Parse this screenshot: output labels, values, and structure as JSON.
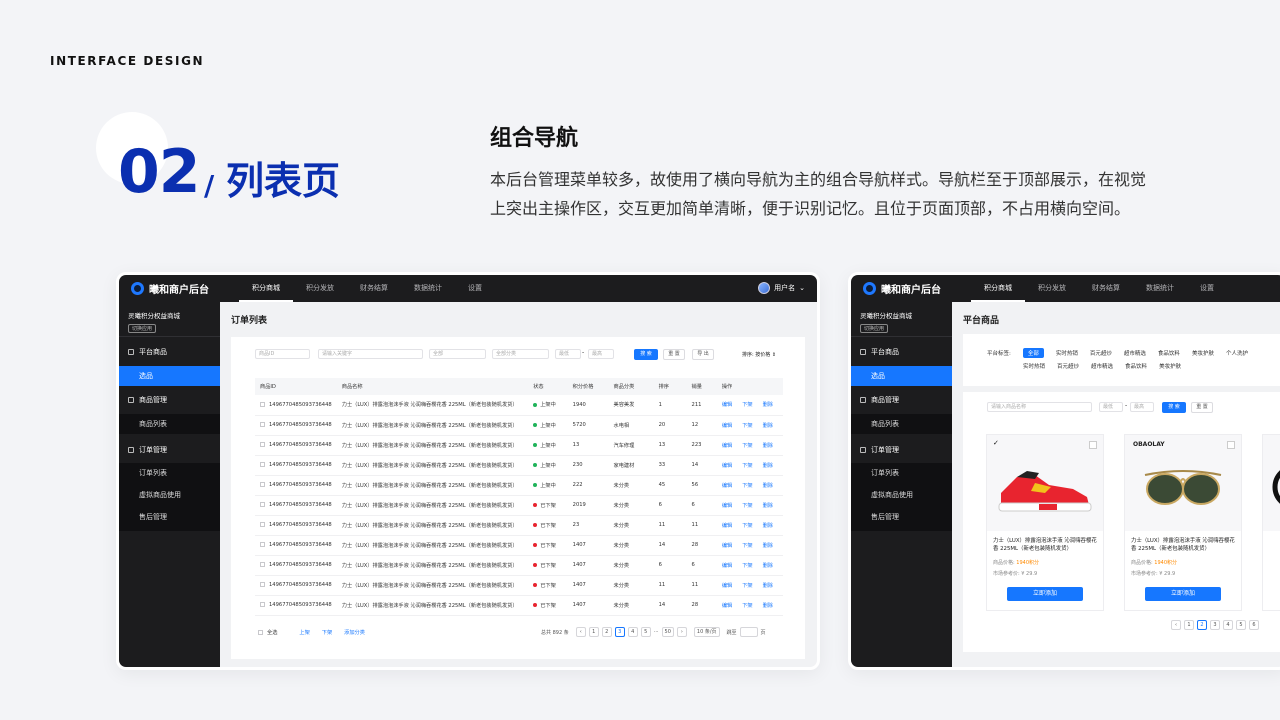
{
  "header": {
    "kicker": "INTERFACE DESIGN",
    "number": "02",
    "slash": "/",
    "title": "列表页"
  },
  "section": {
    "title": "组合导航",
    "line1": "本后台管理菜单较多，故使用了横向导航为主的组合导航样式。导航栏至于顶部展示，在视觉",
    "line2": "上突出主操作区，交互更加简单清晰，便于识别记忆。且位于页面顶部，不占用横向空间。"
  },
  "app": {
    "logo": "曦和商户后台",
    "nav": [
      "积分商城",
      "积分发放",
      "财务结算",
      "数据统计",
      "设置"
    ],
    "user": "用户名",
    "chevron": "⌄",
    "shop": "灵曦积分权益商城",
    "shop_switch": "切换应用"
  },
  "menu": {
    "g1": "平台商品",
    "g1_items": [
      "选品"
    ],
    "g2": "商品管理",
    "g2_items": [
      "商品列表"
    ],
    "g3": "订单管理",
    "g3_items": [
      "订单列表",
      "虚拟商品使用",
      "售后管理"
    ]
  },
  "orders": {
    "page_title": "订单列表",
    "filters": {
      "product_id": "商品ID",
      "keyword": "请输入关键字",
      "all1": "全部",
      "all2": "全部分类",
      "from": "最低",
      "dash": "-",
      "to": "最高",
      "search": "搜 索",
      "reset": "重 置",
      "export": "导 出",
      "sort_label": "排序:",
      "sort_value": "按价格 ⇕"
    },
    "columns": [
      "商品ID",
      "商品名称",
      "状态",
      "积分价格",
      "商品分类",
      "排序",
      "销量",
      "操作"
    ],
    "rows": [
      {
        "id": "14967704850937364​48",
        "name": "力士（LUX）排露泡泡沫手液 沁润嗨吞樱花香 225ML（新老包装随机发货）",
        "status": "上架中",
        "on": true,
        "price": "1940",
        "cat": "美容美发",
        "sort": "1",
        "sales": "211"
      },
      {
        "id": "1496770485093736448",
        "name": "力士（LUX）排露泡泡沫手液 沁润嗨吞樱花香 225ML（新老包装随机发货）",
        "status": "上架中",
        "on": true,
        "price": "5720",
        "cat": "水电相",
        "sort": "20",
        "sales": "12"
      },
      {
        "id": "1496770485093736448",
        "name": "力士（LUX）排露泡泡沫手液 沁润嗨吞樱花香 225ML（新老包装随机发货）",
        "status": "上架中",
        "on": true,
        "price": "13",
        "cat": "汽车修理",
        "sort": "13",
        "sales": "223"
      },
      {
        "id": "1496770485093736448",
        "name": "力士（LUX）排露泡泡沫手液 沁润嗨吞樱花香 225ML（新老包装随机发货）",
        "status": "上架中",
        "on": true,
        "price": "230",
        "cat": "家电建材",
        "sort": "33",
        "sales": "14"
      },
      {
        "id": "1496770485093736448",
        "name": "力士（LUX）排露泡泡沫手液 沁润嗨吞樱花香 225ML（新老包装随机发货）",
        "status": "上架中",
        "on": true,
        "price": "222",
        "cat": "未分类",
        "sort": "45",
        "sales": "56"
      },
      {
        "id": "1496770485093736448",
        "name": "力士（LUX）排露泡泡沫手液 沁润嗨吞樱花香 225ML（新老包装随机发货）",
        "status": "已下架",
        "on": false,
        "price": "2019",
        "cat": "未分类",
        "sort": "6",
        "sales": "6"
      },
      {
        "id": "1496770485093736448",
        "name": "力士（LUX）排露泡泡沫手液 沁润嗨吞樱花香 225ML（新老包装随机发货）",
        "status": "已下架",
        "on": false,
        "price": "23",
        "cat": "未分类",
        "sort": "11",
        "sales": "11"
      },
      {
        "id": "1496770485093736448",
        "name": "力士（LUX）排露泡泡沫手液 沁润嗨吞樱花香 225ML（新老包装随机发货）",
        "status": "已下架",
        "on": false,
        "price": "1407",
        "cat": "未分类",
        "sort": "14",
        "sales": "28"
      },
      {
        "id": "1496770485093736448",
        "name": "力士（LUX）排露泡泡沫手液 沁润嗨吞樱花香 225ML（新老包装随机发货）",
        "status": "已下架",
        "on": false,
        "price": "1407",
        "cat": "未分类",
        "sort": "6",
        "sales": "6"
      },
      {
        "id": "1496770485093736448",
        "name": "力士（LUX）排露泡泡沫手液 沁润嗨吞樱花香 225ML（新老包装随机发货）",
        "status": "已下架",
        "on": false,
        "price": "1407",
        "cat": "未分类",
        "sort": "11",
        "sales": "11"
      },
      {
        "id": "1496770485093736448",
        "name": "力士（LUX）排露泡泡沫手液 沁润嗨吞樱花香 225ML（新老包装随机发货）",
        "status": "已下架",
        "on": false,
        "price": "1407",
        "cat": "未分类",
        "sort": "14",
        "sales": "28"
      }
    ],
    "actions": [
      "编辑",
      "下架",
      "删除"
    ],
    "footer": {
      "select_all": "全选",
      "up": "上架",
      "down": "下架",
      "add_cat": "添加分类"
    },
    "pager": {
      "total": "总共 892 条",
      "prev": "‹",
      "pages": [
        "1",
        "2",
        "3",
        "4",
        "5",
        "···",
        "50"
      ],
      "current": "3",
      "next": "›",
      "size": "10 条/页",
      "goto": "跳至",
      "unit": "页"
    }
  },
  "products": {
    "page_title": "平台商品",
    "tags_label": "平台标签:",
    "tags_row1": [
      "全部",
      "实时热销",
      "百元超炒",
      "超市精选",
      "食品饮料",
      "美妆护肤",
      "个人洗护"
    ],
    "tags_row2": [
      "实时热销",
      "百元超炒",
      "超市精选",
      "食品饮料",
      "美妆护肤"
    ],
    "search_placeholder": "请输入商品名称",
    "from": "最低",
    "dash": "-",
    "to": "最高",
    "search": "搜 索",
    "reset": "重 置",
    "items": [
      {
        "brand": "",
        "name": "力士（LUX）排露泡泡沫手液 沁润嗨吞樱花香 225ML（新老包装随机发货）",
        "price_label": "商品价格:",
        "price": "1940积分",
        "ref_label": "市场参考价:",
        "ref": "¥ 29.9",
        "add": "立即添加"
      },
      {
        "brand": "OBAOLAY",
        "name": "力士（LUX）排露泡泡沫手液 沁润嗨吞樱花香 225ML（新老包装随机发货）",
        "price_label": "商品价格:",
        "price": "1940积分",
        "ref_label": "市场参考价:",
        "ref": "¥ 29.9",
        "add": "立即添加"
      }
    ],
    "pager": {
      "prev": "‹",
      "pages": [
        "1",
        "2",
        "3",
        "4",
        "5",
        "6"
      ],
      "current": "2"
    }
  }
}
